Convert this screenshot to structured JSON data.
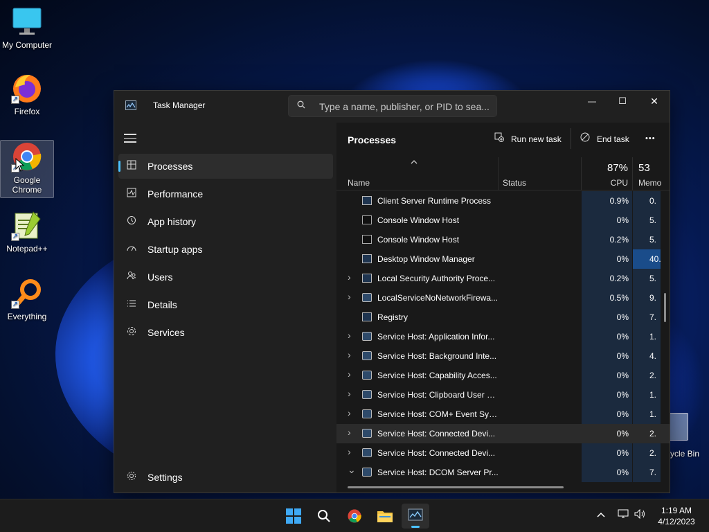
{
  "desktop": {
    "icons": [
      {
        "label": "My Computer"
      },
      {
        "label": "Firefox"
      },
      {
        "label": "Google\nChrome"
      },
      {
        "label": "Notepad++"
      },
      {
        "label": "Everything"
      }
    ],
    "recycle_bin_label": "ycle Bin"
  },
  "window": {
    "title": "Task Manager",
    "search_placeholder": "Type a name, publisher, or PID to sea...",
    "controls": {
      "minimize": "—",
      "maximize": "☐",
      "close": "✕"
    }
  },
  "sidebar": {
    "items": [
      {
        "label": "Processes",
        "icon": "processes-icon",
        "active": true
      },
      {
        "label": "Performance",
        "icon": "performance-icon"
      },
      {
        "label": "App history",
        "icon": "app-history-icon"
      },
      {
        "label": "Startup apps",
        "icon": "startup-apps-icon"
      },
      {
        "label": "Users",
        "icon": "users-icon"
      },
      {
        "label": "Details",
        "icon": "details-icon"
      },
      {
        "label": "Services",
        "icon": "services-icon"
      }
    ],
    "settings_label": "Settings"
  },
  "content": {
    "title": "Processes",
    "run_new_task": "Run new task",
    "end_task": "End task",
    "more": "•••",
    "columns": {
      "name": "Name",
      "status": "Status",
      "cpu_pct": "87%",
      "cpu": "CPU",
      "mem_pct": "53",
      "mem": "Memo"
    },
    "rows": [
      {
        "name": "Client Server Runtime Process",
        "cpu": "0.9%",
        "mem": "0.",
        "expand": false,
        "icon": "app"
      },
      {
        "name": "Console Window Host",
        "cpu": "0%",
        "mem": "5.",
        "expand": false,
        "icon": "console"
      },
      {
        "name": "Console Window Host",
        "cpu": "0.2%",
        "mem": "5.",
        "expand": false,
        "icon": "console"
      },
      {
        "name": "Desktop Window Manager",
        "cpu": "0%",
        "mem": "40.",
        "expand": false,
        "icon": "app",
        "mem_highlight": true
      },
      {
        "name": "Local Security Authority Proce...",
        "cpu": "0.2%",
        "mem": "5.",
        "expand": true,
        "icon": "app"
      },
      {
        "name": "LocalServiceNoNetworkFirewa...",
        "cpu": "0.5%",
        "mem": "9.",
        "expand": true,
        "icon": "svc"
      },
      {
        "name": "Registry",
        "cpu": "0%",
        "mem": "7.",
        "expand": false,
        "icon": "app"
      },
      {
        "name": "Service Host: Application Infor...",
        "cpu": "0%",
        "mem": "1.",
        "expand": true,
        "icon": "svc"
      },
      {
        "name": "Service Host: Background Inte...",
        "cpu": "0%",
        "mem": "4.",
        "expand": true,
        "icon": "svc"
      },
      {
        "name": "Service Host: Capability Acces...",
        "cpu": "0%",
        "mem": "2.",
        "expand": true,
        "icon": "svc"
      },
      {
        "name": "Service Host: Clipboard User S...",
        "cpu": "0%",
        "mem": "1.",
        "expand": true,
        "icon": "svc"
      },
      {
        "name": "Service Host: COM+ Event Sys...",
        "cpu": "0%",
        "mem": "1.",
        "expand": true,
        "icon": "svc"
      },
      {
        "name": "Service Host: Connected Devi...",
        "cpu": "0%",
        "mem": "2.",
        "expand": true,
        "icon": "svc",
        "hover": true
      },
      {
        "name": "Service Host: Connected Devi...",
        "cpu": "0%",
        "mem": "2.",
        "expand": true,
        "icon": "svc"
      },
      {
        "name": "Service Host: DCOM Server Pr...",
        "cpu": "0%",
        "mem": "7.",
        "expand": true,
        "expanded": true,
        "icon": "svc"
      }
    ]
  },
  "taskbar": {
    "clock_time": "1:19 AM",
    "clock_date": "4/12/2023",
    "accent": "#4cc2ff"
  }
}
